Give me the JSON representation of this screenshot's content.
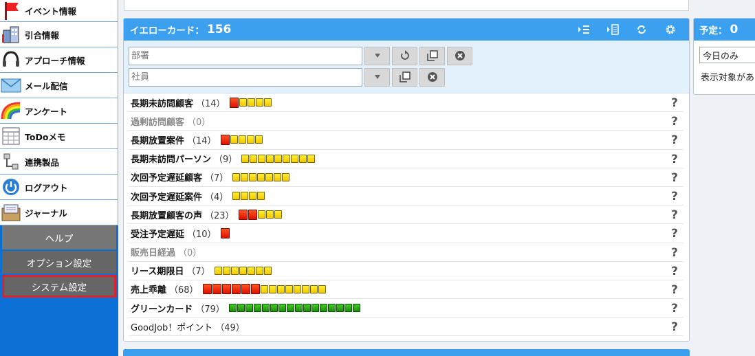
{
  "sidebar": {
    "items": [
      {
        "label": "イベント情報",
        "icon": "flag-icon"
      },
      {
        "label": "引合情報",
        "icon": "building-icon"
      },
      {
        "label": "アプローチ情報",
        "icon": "headset-icon"
      },
      {
        "label": "メール配信",
        "icon": "envelope-icon"
      },
      {
        "label": "アンケート",
        "icon": "rainbow-icon"
      },
      {
        "label": "ToDoメモ",
        "icon": "calendar-icon"
      },
      {
        "label": "連携製品",
        "icon": "network-icon"
      },
      {
        "label": "ログアウト",
        "icon": "power-icon"
      },
      {
        "label": "ジャーナル",
        "icon": "journal-icon"
      }
    ],
    "help_label": "ヘルプ",
    "option_label": "オプション設定",
    "system_label": "システム設定"
  },
  "yellow_card": {
    "title": "イエローカード：",
    "count": "156",
    "dept_placeholder": "部署",
    "staff_placeholder": "社員",
    "rows": [
      {
        "label": "長期未訪問顧客",
        "count": "（14）",
        "red": 1,
        "yellow": 4,
        "green": 0,
        "style": "bold"
      },
      {
        "label": "過剰訪問顧客",
        "count": "（0）",
        "red": 0,
        "yellow": 0,
        "green": 0,
        "style": "dim"
      },
      {
        "label": "長期放置案件",
        "count": "（14）",
        "red": 1,
        "yellow": 4,
        "green": 0,
        "style": "bold"
      },
      {
        "label": "長期未訪問パーソン",
        "count": "（9）",
        "red": 0,
        "yellow": 9,
        "green": 0,
        "style": "bold"
      },
      {
        "label": "次回予定遅延顧客",
        "count": "（7）",
        "red": 0,
        "yellow": 7,
        "green": 0,
        "style": "bold"
      },
      {
        "label": "次回予定遅延案件",
        "count": "（4）",
        "red": 0,
        "yellow": 4,
        "green": 0,
        "style": "bold"
      },
      {
        "label": "長期放置顧客の声",
        "count": "（23）",
        "red": 2,
        "yellow": 3,
        "green": 0,
        "style": "bold"
      },
      {
        "label": "受注予定遅延",
        "count": "（10）",
        "red": 1,
        "yellow": 0,
        "green": 0,
        "style": "bold"
      },
      {
        "label": "販売日経過",
        "count": "（0）",
        "red": 0,
        "yellow": 0,
        "green": 0,
        "style": "dim"
      },
      {
        "label": "リース期限日",
        "count": "（7）",
        "red": 0,
        "yellow": 7,
        "green": 0,
        "style": "bold"
      },
      {
        "label": "売上乖離",
        "count": "（68）",
        "red": 6,
        "yellow": 8,
        "green": 0,
        "style": "bold"
      },
      {
        "label": "グリーンカード",
        "count": "（79）",
        "red": 0,
        "yellow": 0,
        "green": 16,
        "style": "bold"
      },
      {
        "label": "GoodJob！ポイント",
        "count": "（49）",
        "red": 0,
        "yellow": 0,
        "green": 0,
        "style": "normal"
      }
    ],
    "help_mark": "?"
  },
  "schedule": {
    "title": "予定：",
    "count": "0",
    "select_value": "今日のみ",
    "note": "表示対象があ"
  },
  "colors": {
    "sidebar_bg": "#0b6fd6",
    "header_bg": "#3aa0ef",
    "filter_bg": "#e3f1fd",
    "highlight_border": "#e0202a"
  }
}
